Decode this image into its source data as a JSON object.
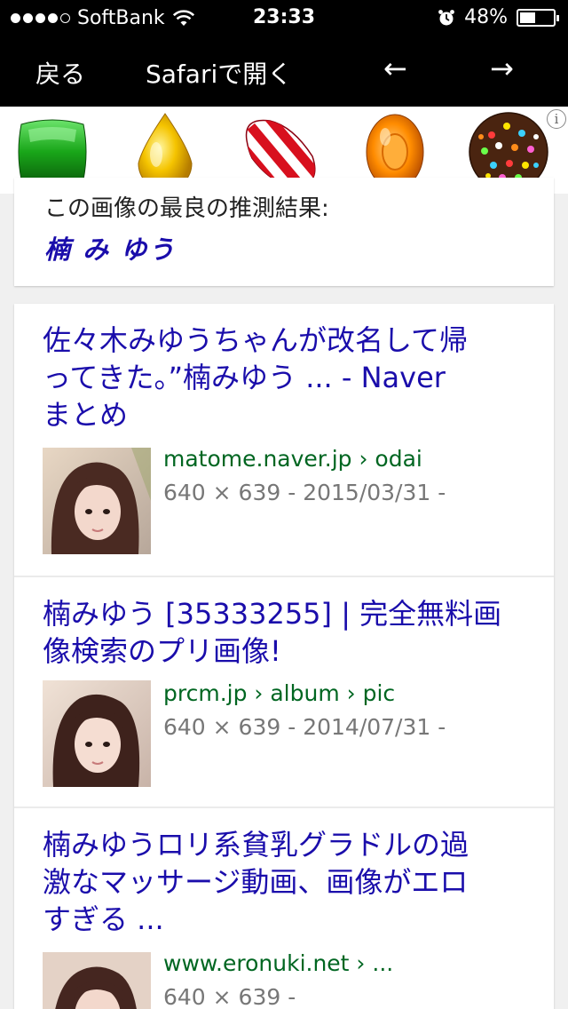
{
  "status_bar": {
    "carrier": "SoftBank",
    "time": "23:33",
    "battery_percent": "48%",
    "battery_level": 0.48,
    "signal_bars_filled": 4,
    "signal_bars_total": 5
  },
  "nav": {
    "back_label": "戻る",
    "open_in_safari_label": "Safariで開く",
    "back_arrow": "←",
    "forward_arrow": "→"
  },
  "ad": {
    "info_glyph": "i",
    "candies": [
      "green-candy",
      "yellow-drop-candy",
      "striped-candy",
      "orange-candy",
      "color-bomb-candy"
    ]
  },
  "best_guess": {
    "label": "この画像の最良の推測結果:",
    "name": "楠 み ゆう"
  },
  "results": [
    {
      "title_lines": [
        "佐々木みゆうちゃんが改名して帰",
        "ってきた。”楠みゆう ... - Naver",
        "まとめ"
      ],
      "url": "matome.naver.jp › odai",
      "meta": "640 × 639 - 2015/03/31 -"
    },
    {
      "title_lines": [
        "楠みゆう [35333255] | 完全無料画",
        "像検索のプリ画像!"
      ],
      "url": "prcm.jp › album › pic",
      "meta": "640 × 639 - 2014/07/31 -"
    },
    {
      "title_lines": [
        "楠みゆうロリ系貧乳グラドルの過",
        "激なマッサージ動画、画像がエロ",
        "すぎる ..."
      ],
      "url": "www.eronuki.net › ...",
      "meta": "640 × 639 -"
    }
  ],
  "colors": {
    "link": "#1a0dab",
    "url": "#006621",
    "meta": "#777777",
    "background": "#f0f0f0"
  }
}
